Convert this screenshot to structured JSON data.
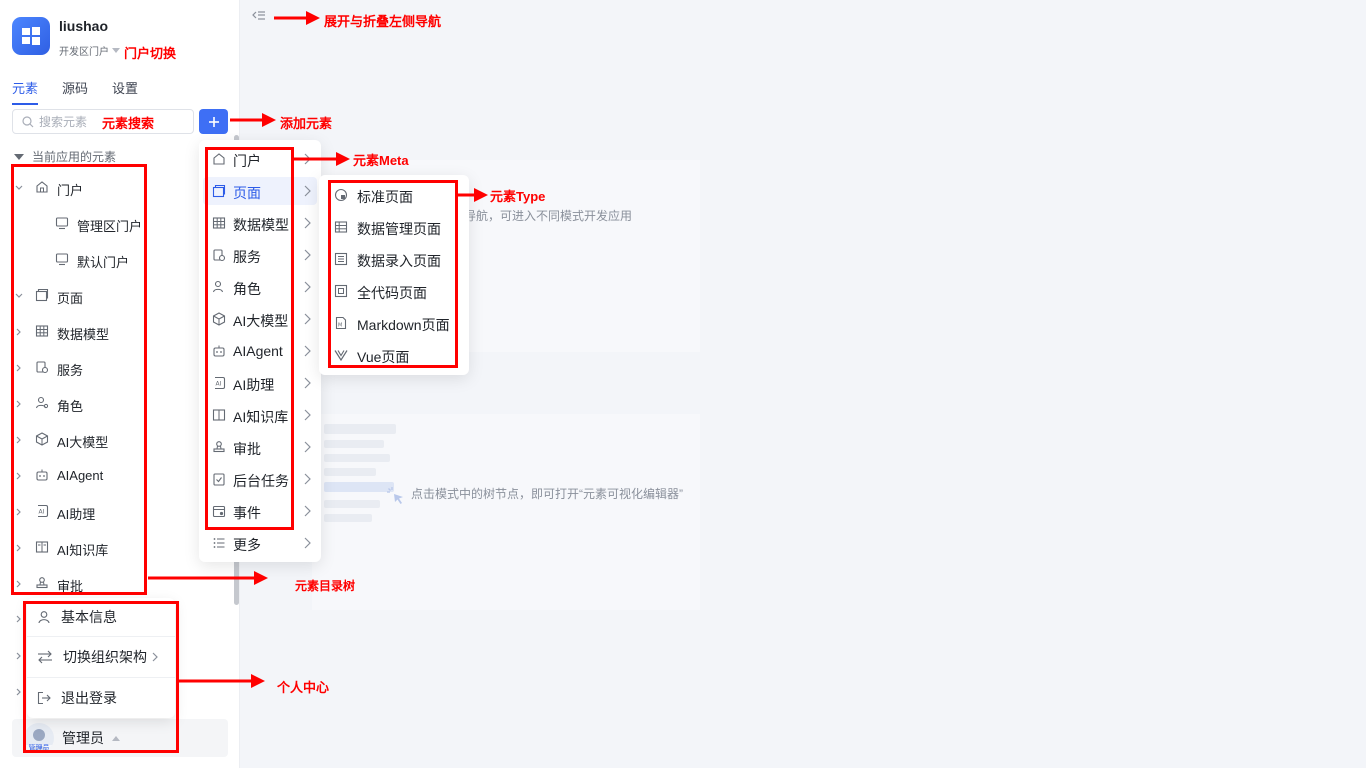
{
  "app": {
    "name": "liushao",
    "portal": "开发区门户"
  },
  "tabs": [
    {
      "label": "元素"
    },
    {
      "label": "源码"
    },
    {
      "label": "设置"
    }
  ],
  "search": {
    "placeholder": "搜索元素"
  },
  "tree": {
    "section_title": "当前应用的元素",
    "items": [
      {
        "label": "门户"
      },
      {
        "label": "管理区门户"
      },
      {
        "label": "默认门户"
      },
      {
        "label": "页面"
      },
      {
        "label": "数据模型"
      },
      {
        "label": "服务"
      },
      {
        "label": "角色"
      },
      {
        "label": "AI大模型"
      },
      {
        "label": "AIAgent"
      },
      {
        "label": "AI助理"
      },
      {
        "label": "AI知识库"
      },
      {
        "label": "审批"
      }
    ]
  },
  "profile_menu": {
    "items": [
      {
        "label": "基本信息"
      },
      {
        "label": "切换组织架构"
      },
      {
        "label": "退出登录"
      }
    ]
  },
  "user": {
    "name": "管理员",
    "avatar_label": "管理员"
  },
  "add_menu": {
    "items": [
      {
        "label": "门户"
      },
      {
        "label": "页面"
      },
      {
        "label": "数据模型"
      },
      {
        "label": "服务"
      },
      {
        "label": "角色"
      },
      {
        "label": "AI大模型"
      },
      {
        "label": "AIAgent"
      },
      {
        "label": "AI助理"
      },
      {
        "label": "AI知识库"
      },
      {
        "label": "审批"
      },
      {
        "label": "后台任务"
      },
      {
        "label": "事件"
      },
      {
        "label": "更多"
      }
    ]
  },
  "page_types": [
    {
      "label": "标准页面"
    },
    {
      "label": "数据管理页面"
    },
    {
      "label": "数据录入页面"
    },
    {
      "label": "全代码页面"
    },
    {
      "label": "Markdown页面"
    },
    {
      "label": "Vue页面"
    }
  ],
  "main": {
    "hint_nav": "侧导航，可进入不同模式开发应用",
    "hint_tree": "点击模式中的树节点，即可打开“元素可视化编辑器”"
  },
  "annotations": {
    "collapse_nav": "展开与折叠左侧导航",
    "portal_switch": "门户切换",
    "search": "元素搜索",
    "add_element": "添加元素",
    "element_meta": "元素Meta",
    "element_type": "元素Type",
    "element_tree": "元素目录树",
    "personal_center": "个人中心"
  },
  "colors": {
    "accent": "#3e6ff5",
    "annotation": "#ff0000"
  }
}
